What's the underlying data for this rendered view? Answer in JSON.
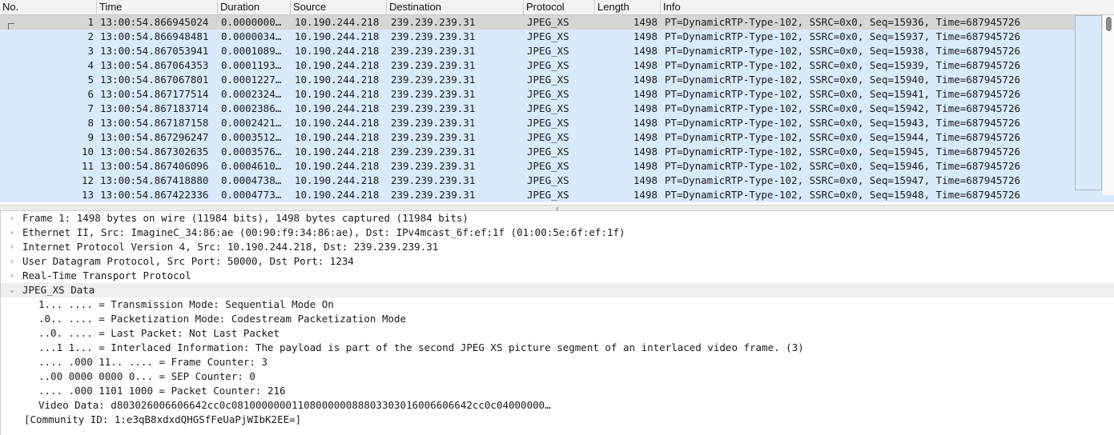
{
  "columns": {
    "no": "No.",
    "time": "Time",
    "duration": "Duration",
    "source": "Source",
    "destination": "Destination",
    "protocol": "Protocol",
    "length": "Length",
    "info": "Info"
  },
  "packets": [
    {
      "no": "1",
      "time": "13:00:54.866945024",
      "duration": "0.0000000…",
      "source": "10.190.244.218",
      "destination": "239.239.239.31",
      "protocol": "JPEG_XS",
      "length": "1498",
      "info": "PT=DynamicRTP-Type-102, SSRC=0x0, Seq=15936, Time=687945726"
    },
    {
      "no": "2",
      "time": "13:00:54.866948481",
      "duration": "0.0000034…",
      "source": "10.190.244.218",
      "destination": "239.239.239.31",
      "protocol": "JPEG_XS",
      "length": "1498",
      "info": "PT=DynamicRTP-Type-102, SSRC=0x0, Seq=15937, Time=687945726"
    },
    {
      "no": "3",
      "time": "13:00:54.867053941",
      "duration": "0.0001089…",
      "source": "10.190.244.218",
      "destination": "239.239.239.31",
      "protocol": "JPEG_XS",
      "length": "1498",
      "info": "PT=DynamicRTP-Type-102, SSRC=0x0, Seq=15938, Time=687945726"
    },
    {
      "no": "4",
      "time": "13:00:54.867064353",
      "duration": "0.0001193…",
      "source": "10.190.244.218",
      "destination": "239.239.239.31",
      "protocol": "JPEG_XS",
      "length": "1498",
      "info": "PT=DynamicRTP-Type-102, SSRC=0x0, Seq=15939, Time=687945726"
    },
    {
      "no": "5",
      "time": "13:00:54.867067801",
      "duration": "0.0001227…",
      "source": "10.190.244.218",
      "destination": "239.239.239.31",
      "protocol": "JPEG_XS",
      "length": "1498",
      "info": "PT=DynamicRTP-Type-102, SSRC=0x0, Seq=15940, Time=687945726"
    },
    {
      "no": "6",
      "time": "13:00:54.867177514",
      "duration": "0.0002324…",
      "source": "10.190.244.218",
      "destination": "239.239.239.31",
      "protocol": "JPEG_XS",
      "length": "1498",
      "info": "PT=DynamicRTP-Type-102, SSRC=0x0, Seq=15941, Time=687945726"
    },
    {
      "no": "7",
      "time": "13:00:54.867183714",
      "duration": "0.0002386…",
      "source": "10.190.244.218",
      "destination": "239.239.239.31",
      "protocol": "JPEG_XS",
      "length": "1498",
      "info": "PT=DynamicRTP-Type-102, SSRC=0x0, Seq=15942, Time=687945726"
    },
    {
      "no": "8",
      "time": "13:00:54.867187158",
      "duration": "0.0002421…",
      "source": "10.190.244.218",
      "destination": "239.239.239.31",
      "protocol": "JPEG_XS",
      "length": "1498",
      "info": "PT=DynamicRTP-Type-102, SSRC=0x0, Seq=15943, Time=687945726"
    },
    {
      "no": "9",
      "time": "13:00:54.867296247",
      "duration": "0.0003512…",
      "source": "10.190.244.218",
      "destination": "239.239.239.31",
      "protocol": "JPEG_XS",
      "length": "1498",
      "info": "PT=DynamicRTP-Type-102, SSRC=0x0, Seq=15944, Time=687945726"
    },
    {
      "no": "10",
      "time": "13:00:54.867302635",
      "duration": "0.0003576…",
      "source": "10.190.244.218",
      "destination": "239.239.239.31",
      "protocol": "JPEG_XS",
      "length": "1498",
      "info": "PT=DynamicRTP-Type-102, SSRC=0x0, Seq=15945, Time=687945726"
    },
    {
      "no": "11",
      "time": "13:00:54.867406096",
      "duration": "0.0004610…",
      "source": "10.190.244.218",
      "destination": "239.239.239.31",
      "protocol": "JPEG_XS",
      "length": "1498",
      "info": "PT=DynamicRTP-Type-102, SSRC=0x0, Seq=15946, Time=687945726"
    },
    {
      "no": "12",
      "time": "13:00:54.867418880",
      "duration": "0.0004738…",
      "source": "10.190.244.218",
      "destination": "239.239.239.31",
      "protocol": "JPEG_XS",
      "length": "1498",
      "info": "PT=DynamicRTP-Type-102, SSRC=0x0, Seq=15947, Time=687945726"
    },
    {
      "no": "13",
      "time": "13:00:54.867422336",
      "duration": "0.0004773…",
      "source": "10.190.244.218",
      "destination": "239.239.239.31",
      "protocol": "JPEG_XS",
      "length": "1498",
      "info": "PT=DynamicRTP-Type-102, SSRC=0x0, Seq=15948, Time=687945726"
    }
  ],
  "selected_row": 0,
  "details": {
    "top_level": [
      {
        "label": "Frame 1: 1498 bytes on wire (11984 bits), 1498 bytes captured (11984 bits)",
        "expanded": false
      },
      {
        "label": "Ethernet II, Src: ImagineC_34:86:ae (00:90:f9:34:86:ae), Dst: IPv4mcast_6f:ef:1f (01:00:5e:6f:ef:1f)",
        "expanded": false
      },
      {
        "label": "Internet Protocol Version 4, Src: 10.190.244.218, Dst: 239.239.239.31",
        "expanded": false
      },
      {
        "label": "User Datagram Protocol, Src Port: 50000, Dst Port: 1234",
        "expanded": false
      },
      {
        "label": "Real-Time Transport Protocol",
        "expanded": false
      },
      {
        "label": "JPEG_XS Data",
        "expanded": true
      }
    ],
    "jpeg_xs_fields": [
      "1... .... = Transmission Mode: Sequential Mode On",
      ".0.. .... = Packetization Mode: Codestream Packetization Mode",
      "..0. .... = Last Packet: Not Last Packet",
      "...1 1... = Interlaced Information: The payload is part of the second JPEG XS picture segment of an interlaced video frame. (3)",
      ".... .000 11.. .... = Frame Counter: 3",
      "..00 0000 0000 0... = SEP Counter: 0",
      ".... .000 1101 1000 = Packet Counter: 216",
      "Video Data: d803026006606642cc0c081000000011080000008880330301600660664​2cc0c04000000…"
    ],
    "community_id": "[Community ID: 1:e3qB8xdxdQHGSfFeUaPjWIbK2EE=]"
  },
  "icons": {
    "collapsed": "chevron-right-icon",
    "expanded": "chevron-down-icon"
  },
  "colors": {
    "row_udp_blue": "#d9eafb",
    "row_selected": "#d6d6d6",
    "detail_highlight": "#efefef"
  }
}
